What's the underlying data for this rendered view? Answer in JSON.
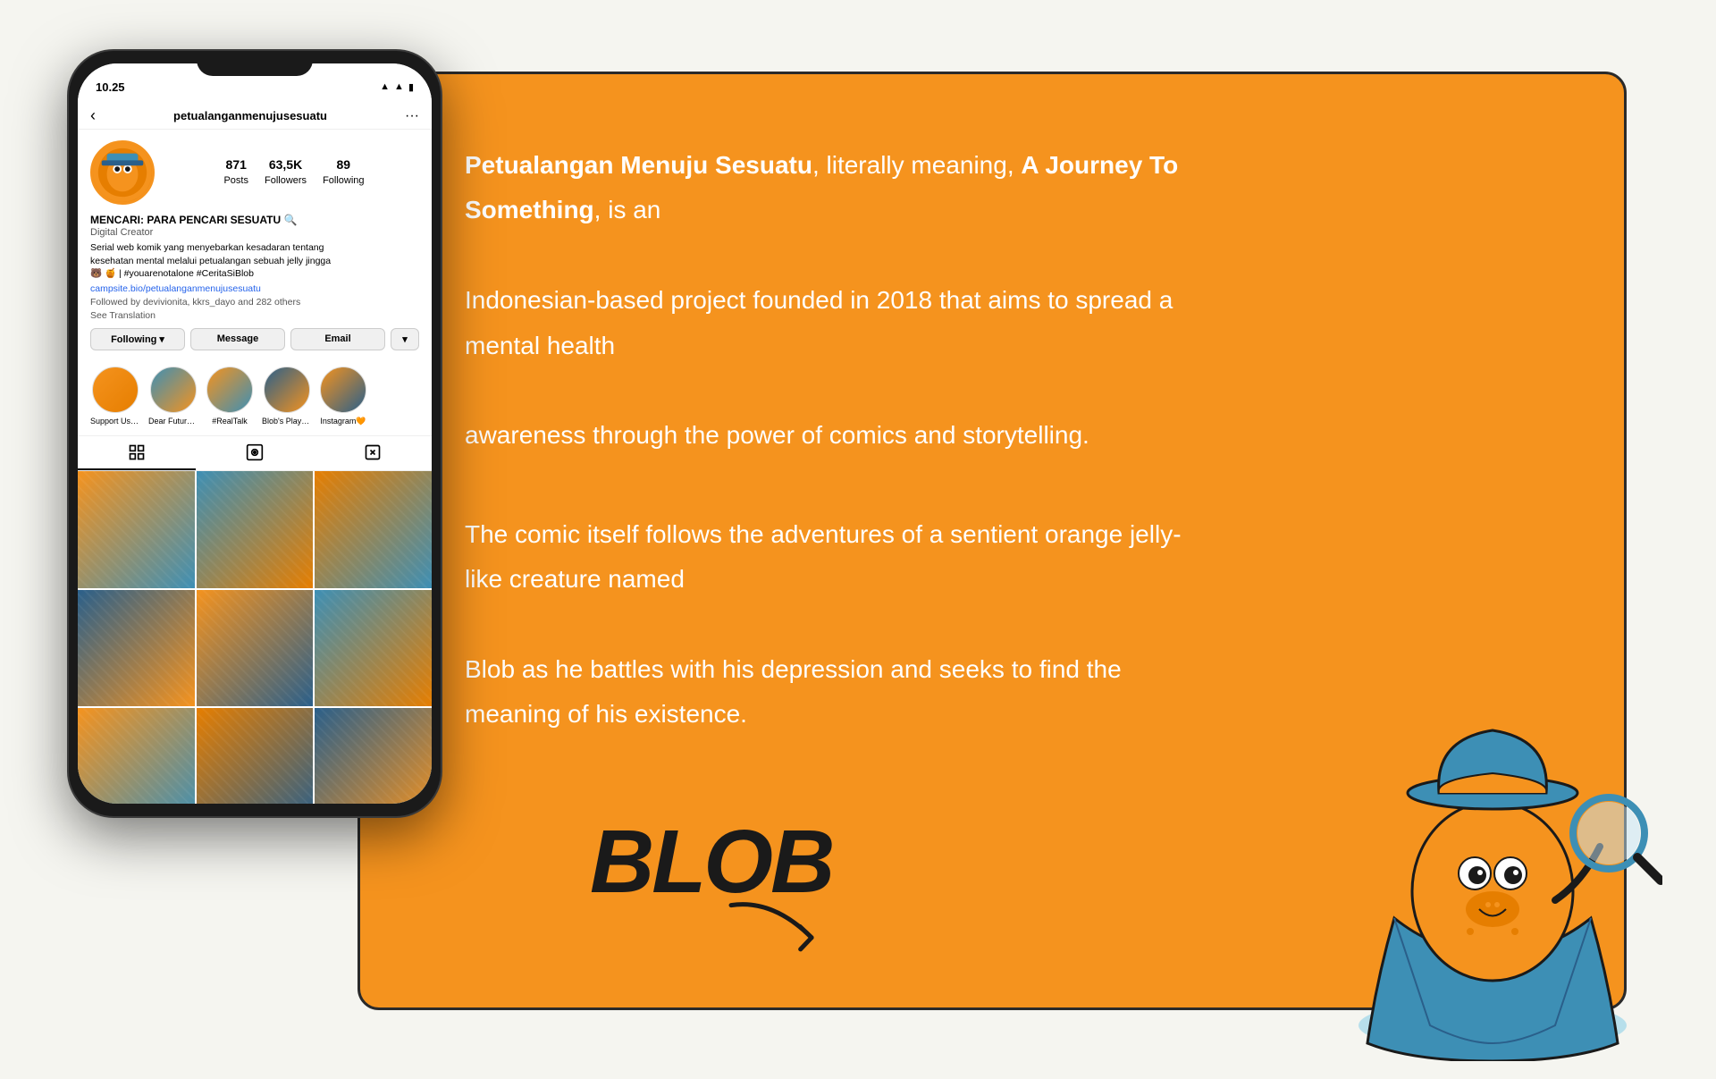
{
  "page": {
    "background_color": "#f5f5f0"
  },
  "orange_card": {
    "background_color": "#F5931E",
    "border_color": "#2a2a2a"
  },
  "phone": {
    "status_bar": {
      "time": "10.25",
      "icons": "▲ ▲ ▲"
    },
    "header": {
      "back_icon": "‹",
      "username": "petualanganmenujusesuatu",
      "more_icon": "···"
    },
    "profile": {
      "stats": [
        {
          "value": "871",
          "label": "Posts"
        },
        {
          "value": "63,5K",
          "label": "Followers"
        },
        {
          "value": "89",
          "label": "Following"
        }
      ],
      "bio_name": "MENCARI: PARA PENCARI SESUATU 🔍",
      "bio_type": "Digital Creator",
      "bio_text": "Serial web komik yang menyebarkan kesadaran tentang\nkesehatan mental melalui petualangan sebuah jelly jingga\n🐻 🍯 | #youarenotalone #CeritaSiBlob",
      "bio_link": "campsite.bio/petualanganmenujusesuatu",
      "bio_followed": "Followed by devivionita, kkrs_dayo and 282 others",
      "bio_translate": "See Translation"
    },
    "buttons": {
      "following": "Following",
      "following_chevron": "▾",
      "message": "Message",
      "email": "Email",
      "dropdown": "▾"
    },
    "highlights": [
      {
        "label": "Support Us!..."
      },
      {
        "label": "Dear Future..."
      },
      {
        "label": "#RealTalk"
      },
      {
        "label": "Blob's Playlist"
      },
      {
        "label": "Instagram🧡"
      }
    ],
    "grid_count": 12
  },
  "description": {
    "paragraph1": {
      "bold1": "Petualangan Menuju Sesuatu",
      "text1": ", literally meaning, ",
      "bold2": "A Journey To Something",
      "text2": ", is an Indonesian-based project founded in 2018 that aims to spread a mental health awareness through the power of comics and storytelling."
    },
    "paragraph2": "The comic itself follows the adventures of a sentient orange jelly-like creature named Blob as he battles with his depression and seeks to find the meaning of his existence."
  },
  "blob_label": "BLOB",
  "icons": {
    "grid": "grid-icon",
    "reels": "reels-icon",
    "tagged": "tagged-icon",
    "back": "back-arrow-icon",
    "more": "more-options-icon"
  }
}
